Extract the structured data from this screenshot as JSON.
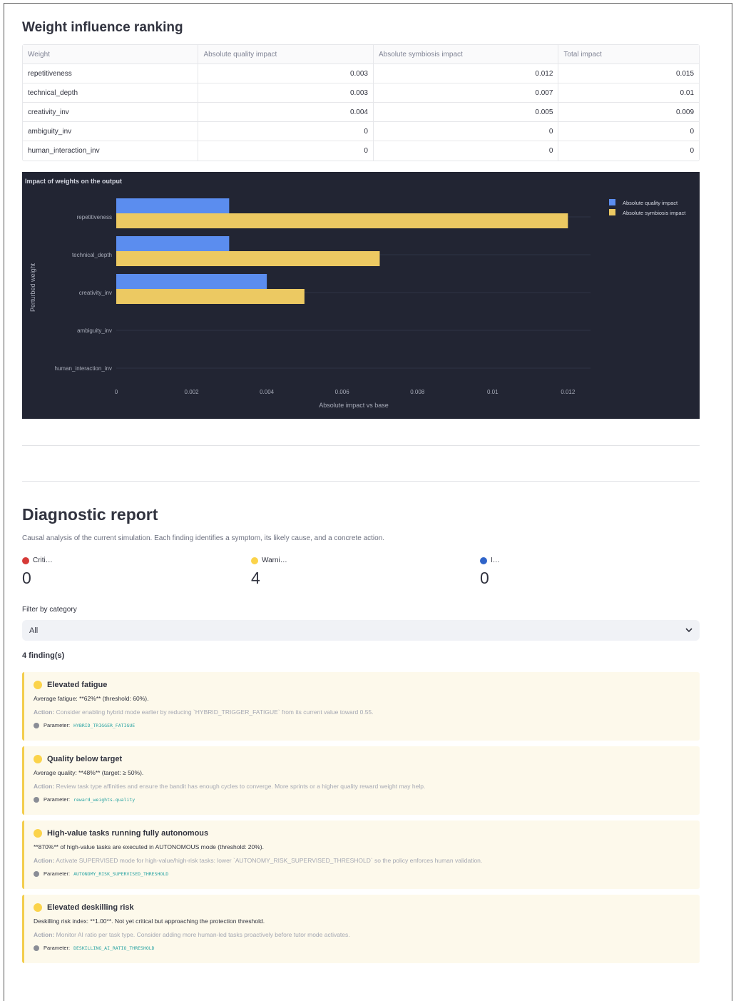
{
  "influence": {
    "title": "Weight influence ranking",
    "headers": [
      "Weight",
      "Absolute quality impact",
      "Absolute symbiosis impact",
      "Total impact"
    ],
    "rows": [
      [
        "repetitiveness",
        "0.003",
        "0.012",
        "0.015"
      ],
      [
        "technical_depth",
        "0.003",
        "0.007",
        "0.01"
      ],
      [
        "creativity_inv",
        "0.004",
        "0.005",
        "0.009"
      ],
      [
        "ambiguity_inv",
        "0",
        "0",
        "0"
      ],
      [
        "human_interaction_inv",
        "0",
        "0",
        "0"
      ]
    ]
  },
  "chart_data": {
    "type": "bar",
    "orientation": "horizontal",
    "title": "Impact of weights on the output",
    "xlabel": "Absolute impact vs base",
    "ylabel": "Perturbed weight",
    "categories": [
      "repetitiveness",
      "technical_depth",
      "creativity_inv",
      "ambiguity_inv",
      "human_interaction_inv"
    ],
    "series": [
      {
        "name": "Absolute quality impact",
        "values": [
          0.003,
          0.003,
          0.004,
          0,
          0
        ],
        "color": "#5b8def"
      },
      {
        "name": "Absolute symbiosis impact",
        "values": [
          0.012,
          0.007,
          0.005,
          0,
          0
        ],
        "color": "#ecc962"
      }
    ],
    "x_ticks": [
      "0",
      "0.002",
      "0.004",
      "0.006",
      "0.008",
      "0.01",
      "0.012"
    ],
    "xlim": [
      0,
      0.0126
    ],
    "legend_position": "top-right",
    "background": "#222533"
  },
  "report": {
    "title": "Diagnostic report",
    "caption": "Causal analysis of the current simulation. Each finding identifies a symptom, its likely cause, and a concrete action.",
    "metrics": [
      {
        "label": "Criti…",
        "value": "0",
        "color": "#d63a37"
      },
      {
        "label": "Warni…",
        "value": "4",
        "color": "#fbd34a"
      },
      {
        "label": "I…",
        "value": "0",
        "color": "#2f64c9"
      }
    ],
    "filter_label": "Filter by category",
    "filter_value": "All",
    "count_text": "4 finding(s)",
    "findings": [
      {
        "title": "Elevated fatigue",
        "line": "Average fatigue: **62%** (threshold: 60%).",
        "action_label": "Action:",
        "action": "Consider enabling hybrid mode earlier by reducing `HYBRID_TRIGGER_FATIGUE` from its current value toward 0.55.",
        "param_label": "Parameter:",
        "param": "HYBRID_TRIGGER_FATIGUE"
      },
      {
        "title": "Quality below target",
        "line": "Average quality: **48%** (target: ≥ 50%).",
        "action_label": "Action:",
        "action": "Review task type affinities and ensure the bandit has enough cycles to converge. More sprints or a higher quality reward weight may help.",
        "param_label": "Parameter:",
        "param": "reward_weights.quality"
      },
      {
        "title": "High-value tasks running fully autonomous",
        "line": "**870%** of high-value tasks are executed in AUTONOMOUS mode (threshold: 20%).",
        "action_label": "Action:",
        "action": "Activate SUPERVISED mode for high-value/high-risk tasks: lower `AUTONOMY_RISK_SUPERVISED_THRESHOLD` so the policy enforces human validation.",
        "param_label": "Parameter:",
        "param": "AUTONOMY_RISK_SUPERVISED_THRESHOLD"
      },
      {
        "title": "Elevated deskilling risk",
        "line": "Deskilling risk index: **1.00**. Not yet critical but approaching the protection threshold.",
        "action_label": "Action:",
        "action": "Monitor AI ratio per task type. Consider adding more human-led tasks proactively before tutor mode activates.",
        "param_label": "Parameter:",
        "param": "DESKILLING_AI_RATIO_THRESHOLD"
      }
    ]
  }
}
